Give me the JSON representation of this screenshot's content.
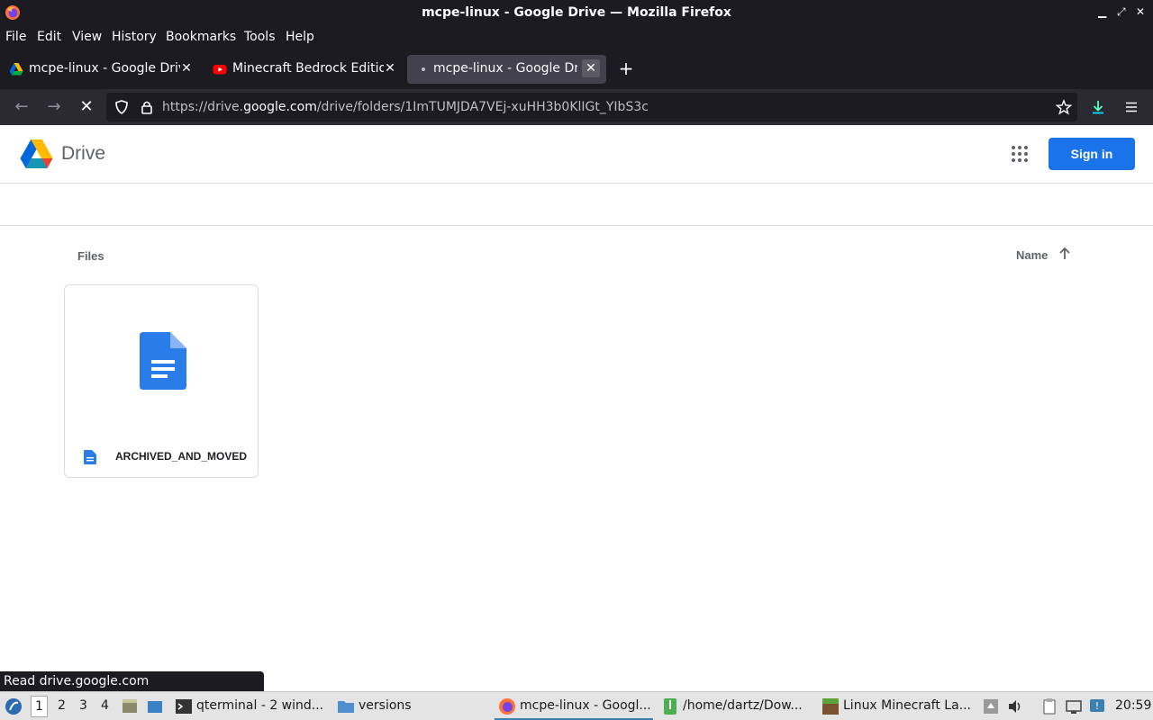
{
  "window": {
    "title": "mcpe-linux - Google Drive — Mozilla Firefox"
  },
  "menu": [
    "File",
    "Edit",
    "View",
    "History",
    "Bookmarks",
    "Tools",
    "Help"
  ],
  "tabs": [
    {
      "label": "mcpe-linux - Google Drive",
      "favicon": "google-drive-icon",
      "selected": false
    },
    {
      "label": "Minecraft Bedrock Edition",
      "favicon": "youtube-icon",
      "selected": false
    },
    {
      "label": "mcpe-linux - Google Drive",
      "favicon": "loading-icon",
      "selected": true
    }
  ],
  "navbar": {
    "url_prefix": "https://drive.",
    "url_host": "google.com",
    "url_path": "/drive/folders/1ImTUMJDA7VEj-xuHH3b0KlIGt_YIbS3c"
  },
  "drive": {
    "title": "Drive",
    "signin_label": "Sign in",
    "files_heading": "Files",
    "sort_label": "Name",
    "files": [
      {
        "name": "ARCHIVED_AND_MOVED",
        "type": "google-docs"
      }
    ]
  },
  "status_text": "Read drive.google.com",
  "taskbar": {
    "workspaces": [
      "1",
      "2",
      "3",
      "4"
    ],
    "active_workspace": "1",
    "tasks": [
      {
        "label": "qterminal - 2 wind...",
        "icon": "terminal-icon"
      },
      {
        "label": "versions",
        "icon": "folder-icon"
      },
      {
        "label": "mcpe-linux - Googl...",
        "icon": "firefox-icon",
        "active": true
      },
      {
        "label": "/home/dartz/Dow...",
        "icon": "archive-icon"
      },
      {
        "label": "Linux Minecraft La...",
        "icon": "minecraft-icon"
      }
    ],
    "clock": "20:59"
  },
  "colors": {
    "accent": "#1a73e8",
    "firefox_dark": "#1c1b22",
    "toolbar": "#2b2a33"
  }
}
